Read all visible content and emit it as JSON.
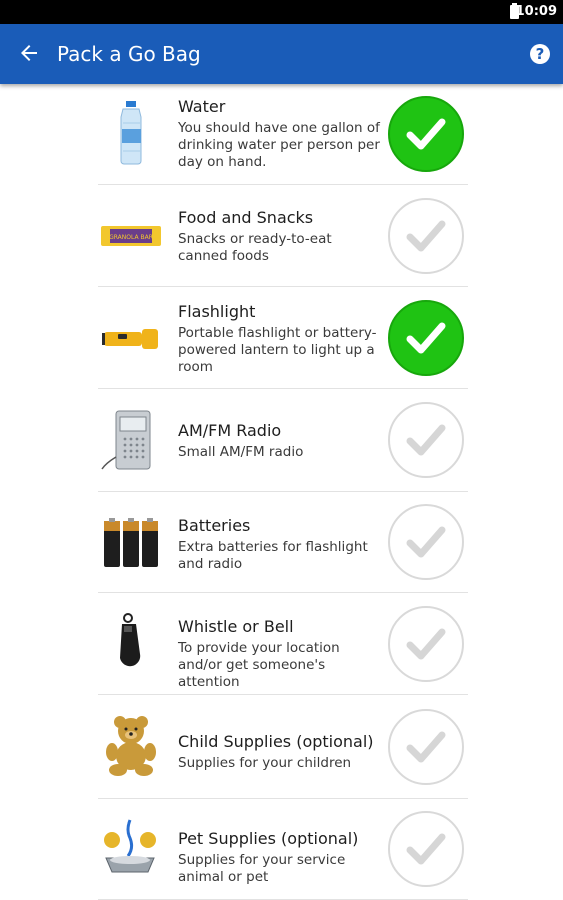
{
  "status": {
    "time": "10:09"
  },
  "appbar": {
    "title": "Pack a Go Bag",
    "help_glyph": "?"
  },
  "items": [
    {
      "name": "Water",
      "desc": "You should have one gallon of drinking water per person per day on hand.",
      "checked": true,
      "icon": "water-bottle-icon"
    },
    {
      "name": "Food and Snacks",
      "desc": "Snacks or ready-to-eat canned foods",
      "checked": false,
      "icon": "granola-bar-icon",
      "icon_text": "GRANOLA BAR"
    },
    {
      "name": "Flashlight",
      "desc": "Portable flashlight or battery-powered lantern to light up a room",
      "checked": true,
      "icon": "flashlight-icon"
    },
    {
      "name": "AM/FM Radio",
      "desc": "Small AM/FM radio",
      "checked": false,
      "icon": "radio-icon"
    },
    {
      "name": "Batteries",
      "desc": "Extra batteries for flashlight and radio",
      "checked": false,
      "icon": "batteries-icon"
    },
    {
      "name": "Whistle or Bell",
      "desc": "To provide your location and/or get someone's attention",
      "checked": false,
      "icon": "whistle-icon"
    },
    {
      "name": "Child Supplies (optional)",
      "desc": "Supplies for your children",
      "checked": false,
      "icon": "teddy-bear-icon"
    },
    {
      "name": "Pet Supplies (optional)",
      "desc": "Supplies for your service animal or pet",
      "checked": false,
      "icon": "pet-supplies-icon"
    }
  ],
  "colors": {
    "appbar": "#1a5cb8",
    "checked": "#1fc313",
    "unchecked_border": "#d9d9d9"
  }
}
